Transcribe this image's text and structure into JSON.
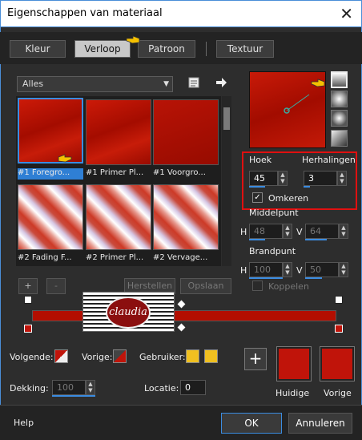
{
  "window": {
    "title": "Eigenschappen van materiaal",
    "close": "✕"
  },
  "tabs": [
    {
      "label": "Kleur",
      "active": false
    },
    {
      "label": "Verloop",
      "active": true
    },
    {
      "label": "Patroon",
      "active": false
    },
    {
      "label": "Textuur",
      "active": false
    }
  ],
  "library": {
    "category": "Alles",
    "items": [
      {
        "label": "#1 Foregro...",
        "selected": true
      },
      {
        "label": "#1 Primer Pl...",
        "selected": false
      },
      {
        "label": "#1 Voorgro...",
        "selected": false
      },
      {
        "label": "#2 Fading F...",
        "selected": false
      },
      {
        "label": "#2 Primer Pl...",
        "selected": false
      },
      {
        "label": "#2 Vervage...",
        "selected": false
      }
    ],
    "add": "+",
    "remove": "-",
    "restore": "Herstellen",
    "save": "Opslaan"
  },
  "gradient": {
    "hoek_label": "Hoek",
    "hoek": "45",
    "herhalingen_label": "Herhalingen",
    "herhalingen": "3",
    "omkeren_label": "Omkeren",
    "omkeren": true,
    "middelpunt_label": "Middelpunt",
    "mid_h_label": "H",
    "mid_h": "48",
    "mid_v_label": "V",
    "mid_v": "64",
    "brandpunt_label": "Brandpunt",
    "focus_h_label": "H",
    "focus_h": "100",
    "focus_v_label": "V",
    "focus_v": "50",
    "koppelen_label": "Koppelen",
    "koppelen": false
  },
  "watermark": {
    "text": "claudia"
  },
  "stop_options": {
    "volgende_label": "Volgende:",
    "vorige_label": "Vorige:",
    "gebruiker_label": "Gebruiker:",
    "dekking_label": "Dekking:",
    "dekking": "100",
    "locatie_label": "Locatie:",
    "locatie": "0"
  },
  "colors": {
    "huidige_label": "Huidige",
    "vorige_label": "Vorige",
    "huidige": "#c0140a",
    "vorige": "#c0140a",
    "user_swatch": "#f0c020",
    "accent": "#3b8ce0",
    "highlight": "#e01010"
  },
  "footer": {
    "help": "Help",
    "ok": "OK",
    "cancel": "Annuleren"
  }
}
